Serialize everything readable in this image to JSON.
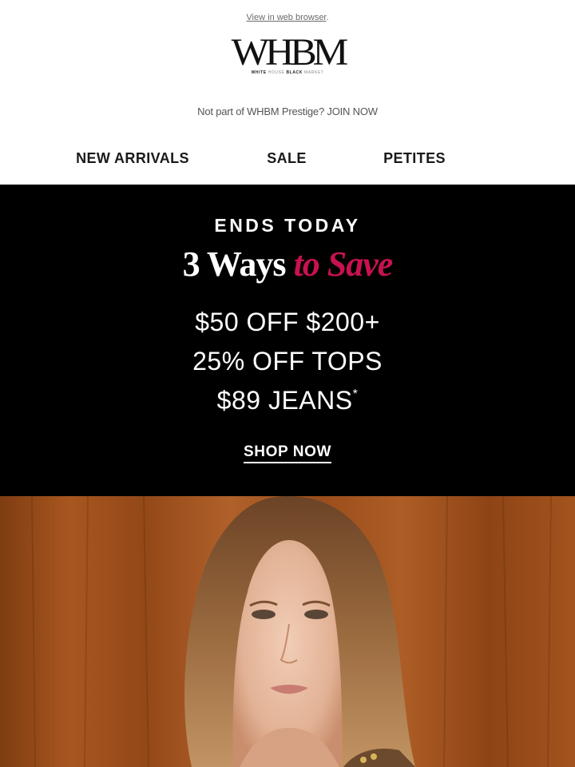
{
  "header": {
    "web_link": "View in web browser",
    "web_link_suffix": ".",
    "logo_text": "WHBM",
    "logo_sub_1": "WHITE",
    "logo_sub_2": "HOUSE",
    "logo_sub_3": "BLACK",
    "logo_sub_4": "MARKET",
    "prestige_text": "Not part of WHBM Prestige?",
    "prestige_link": "JOIN NOW"
  },
  "nav": {
    "items": [
      {
        "label": "NEW ARRIVALS"
      },
      {
        "label": "SALE"
      },
      {
        "label": "PETITES"
      }
    ]
  },
  "promo": {
    "ends": "ENDS TODAY",
    "headline_main": "3 Ways",
    "headline_accent": "to Save",
    "offers": [
      {
        "text": "$50 OFF $200+"
      },
      {
        "text": "25% OFF TOPS"
      },
      {
        "text": "$89 JEANS",
        "mark": "*"
      }
    ],
    "cta": "SHOP NOW"
  },
  "colors": {
    "accent": "#c8124e",
    "promo_bg": "#000000",
    "wood": "#a8561f"
  }
}
